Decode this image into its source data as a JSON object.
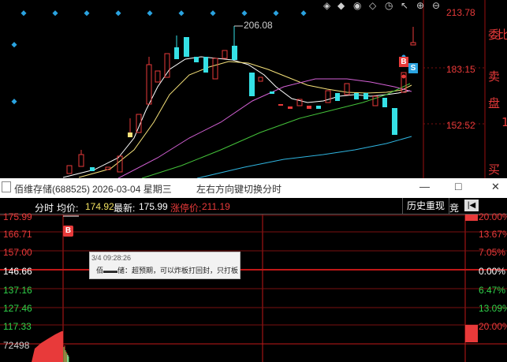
{
  "kline": {
    "peak_label": "206.08",
    "price_levels": [
      "213.78",
      "183.15",
      "152.52"
    ],
    "side_chars": [
      "委",
      "比",
      "卖",
      "盘",
      "1",
      "买"
    ],
    "marks": {
      "buy": "B",
      "sell": "S"
    }
  },
  "window": {
    "title": "佰维存储(688525)",
    "date": "2026-03-04 星期三",
    "hint": "左右方向键切换分时",
    "min_btn": "—",
    "max_btn": "□",
    "close_btn": "✕"
  },
  "infobar": {
    "mode": "分时",
    "avg_label": "均价:",
    "avg_value": "174.92",
    "last_label": "最新:",
    "last_value": "175.99",
    "limit_label": "涨停价:",
    "limit_value": "211.19",
    "history_btn": "历史重现",
    "bid_btn": "竞",
    "prev_btn": "|◀"
  },
  "intraday": {
    "left_labels": [
      "175.99",
      "166.71",
      "157.00",
      "146.66",
      "137.16",
      "127.46",
      "117.33",
      "72498"
    ],
    "right_labels": [
      "20.00%",
      "13.67%",
      "7.05%",
      "0.00%",
      "6.47%",
      "13.09%",
      "20.00%"
    ],
    "buy_mark": "B",
    "tooltip_time": "3/4 09:28:26",
    "tooltip_text": "佰▬▬储：超预期，可以炸板打回封，只打板"
  },
  "colors": {
    "up": "#e83a3a",
    "down": "#35e1e6",
    "avg": "#f0e060",
    "grid": "#7a1010"
  }
}
